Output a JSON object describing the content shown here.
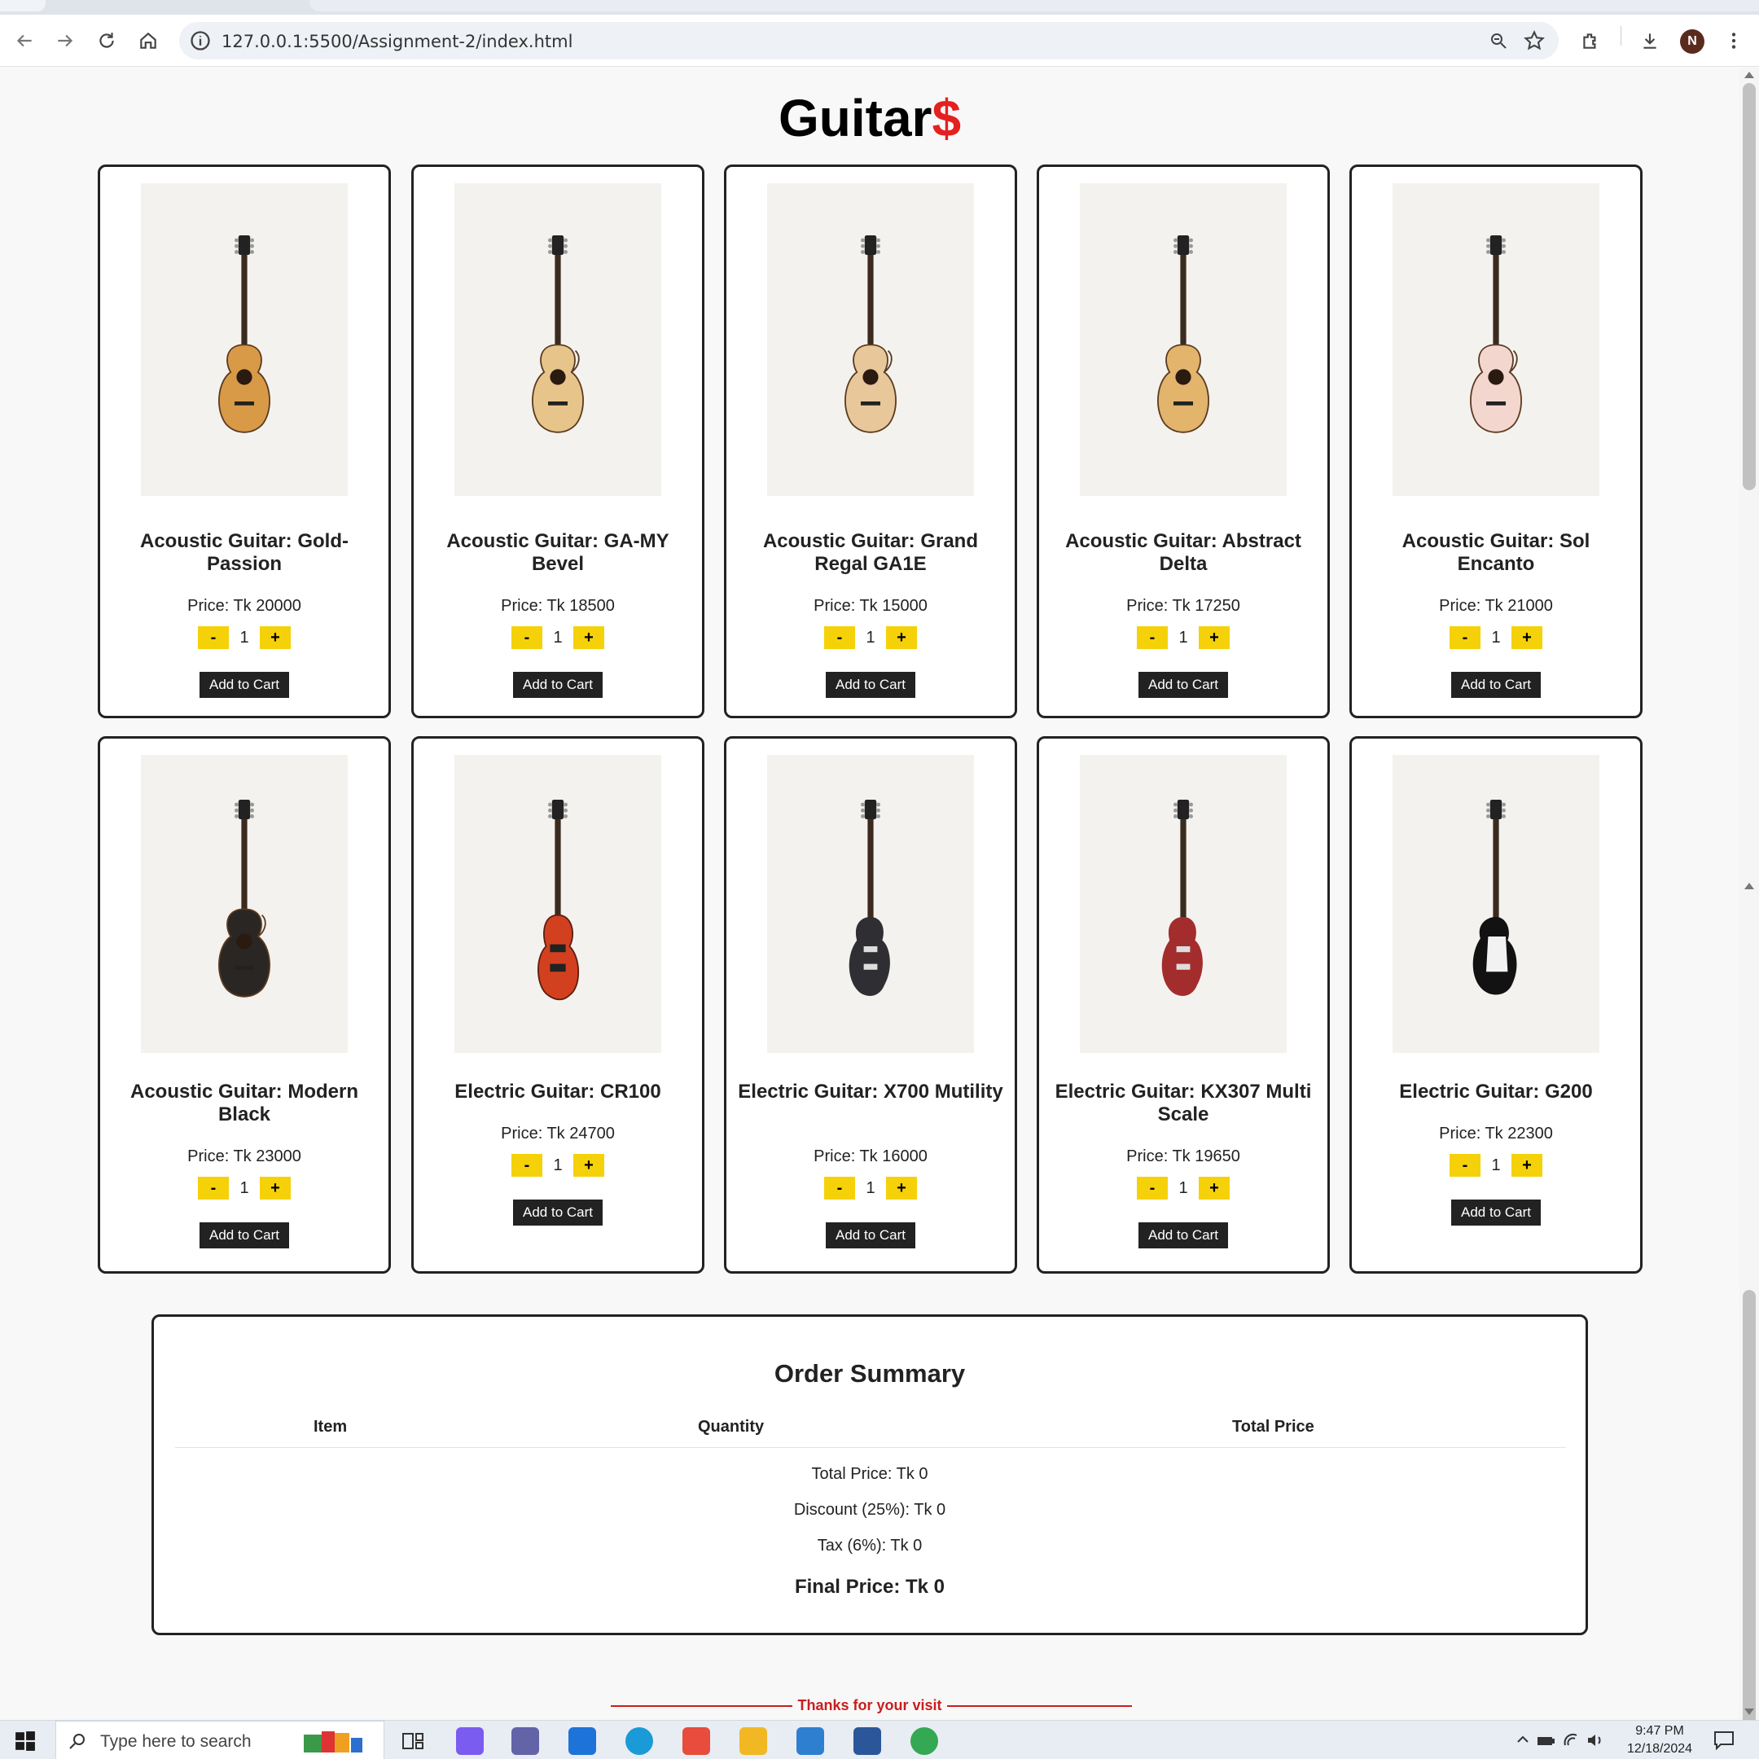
{
  "browser": {
    "url": "127.0.0.1:5500/Assignment-2/index.html",
    "profile_initial": "N",
    "icons": [
      "back-icon",
      "forward-icon",
      "reload-icon",
      "home-icon",
      "site-info-icon",
      "zoom-icon",
      "bookmark-star-icon",
      "extensions-icon",
      "download-icon",
      "menu-icon"
    ]
  },
  "page": {
    "title_main": "Guitar",
    "title_accent": "$",
    "accent_color": "#e52020",
    "button_yellow": "#f5d10a"
  },
  "products": [
    {
      "name": "Acoustic Guitar: Gold-Passion",
      "price": "Price: Tk 20000",
      "qty": "1",
      "minus": "-",
      "plus": "+",
      "cart": "Add to Cart",
      "kind": "acoustic",
      "color": "#d89a47"
    },
    {
      "name": "Acoustic Guitar: GA-MY Bevel",
      "price": "Price: Tk 18500",
      "qty": "1",
      "minus": "-",
      "plus": "+",
      "cart": "Add to Cart",
      "kind": "acoustic-cut",
      "color": "#e7c48a"
    },
    {
      "name": "Acoustic Guitar: Grand Regal GA1E",
      "price": "Price: Tk 15000",
      "qty": "1",
      "minus": "-",
      "plus": "+",
      "cart": "Add to Cart",
      "kind": "acoustic-cut",
      "color": "#e8c79a"
    },
    {
      "name": "Acoustic Guitar: Abstract Delta",
      "price": "Price: Tk 17250",
      "qty": "1",
      "minus": "-",
      "plus": "+",
      "cart": "Add to Cart",
      "kind": "acoustic",
      "color": "#e2b46c"
    },
    {
      "name": "Acoustic Guitar: Sol Encanto",
      "price": "Price: Tk 21000",
      "qty": "1",
      "minus": "-",
      "plus": "+",
      "cart": "Add to Cart",
      "kind": "acoustic-cut",
      "color": "#f3d7cf"
    },
    {
      "name": "Acoustic Guitar: Modern Black",
      "price": "Price: Tk 23000",
      "qty": "1",
      "minus": "-",
      "plus": "+",
      "cart": "Add to Cart",
      "kind": "acoustic-cut",
      "color": "#2a2624"
    },
    {
      "name": "Electric Guitar: CR100",
      "price": "Price: Tk 24700",
      "qty": "1",
      "minus": "-",
      "plus": "+",
      "cart": "Add to Cart",
      "kind": "lespaul",
      "color": "#d2401f"
    },
    {
      "name": "Electric Guitar: X700 Mutility",
      "price": "Price: Tk 16000",
      "qty": "1",
      "minus": "-",
      "plus": "+",
      "cart": "Add to Cart",
      "kind": "electric",
      "color": "#2f2f33"
    },
    {
      "name": "Electric Guitar: KX307 Multi Scale",
      "price": "Price: Tk 19650",
      "qty": "1",
      "minus": "-",
      "plus": "+",
      "cart": "Add to Cart",
      "kind": "electric",
      "color": "#a32d2d"
    },
    {
      "name": "Electric Guitar: G200",
      "price": "Price: Tk 22300",
      "qty": "1",
      "minus": "-",
      "plus": "+",
      "cart": "Add to Cart",
      "kind": "strat",
      "color": "#121212"
    }
  ],
  "summary": {
    "title": "Order Summary",
    "col_item": "Item",
    "col_quantity": "Quantity",
    "col_total": "Total Price",
    "total_price": "Total Price: Tk 0",
    "discount": "Discount (25%): Tk 0",
    "tax": "Tax (6%): Tk 0",
    "final_price": "Final Price: Tk 0"
  },
  "footer": {
    "text": "Thanks for your visit",
    "color": "#c81e1e"
  },
  "taskbar": {
    "search_placeholder": "Type here to search",
    "time": "9:47 PM",
    "date": "12/18/2024",
    "apps": [
      "task-view-icon",
      "copilot-icon",
      "teams-icon",
      "mail-icon",
      "edge-icon",
      "paint-icon",
      "file-explorer-icon",
      "vscode-icon",
      "word-icon",
      "chrome-icon"
    ]
  }
}
